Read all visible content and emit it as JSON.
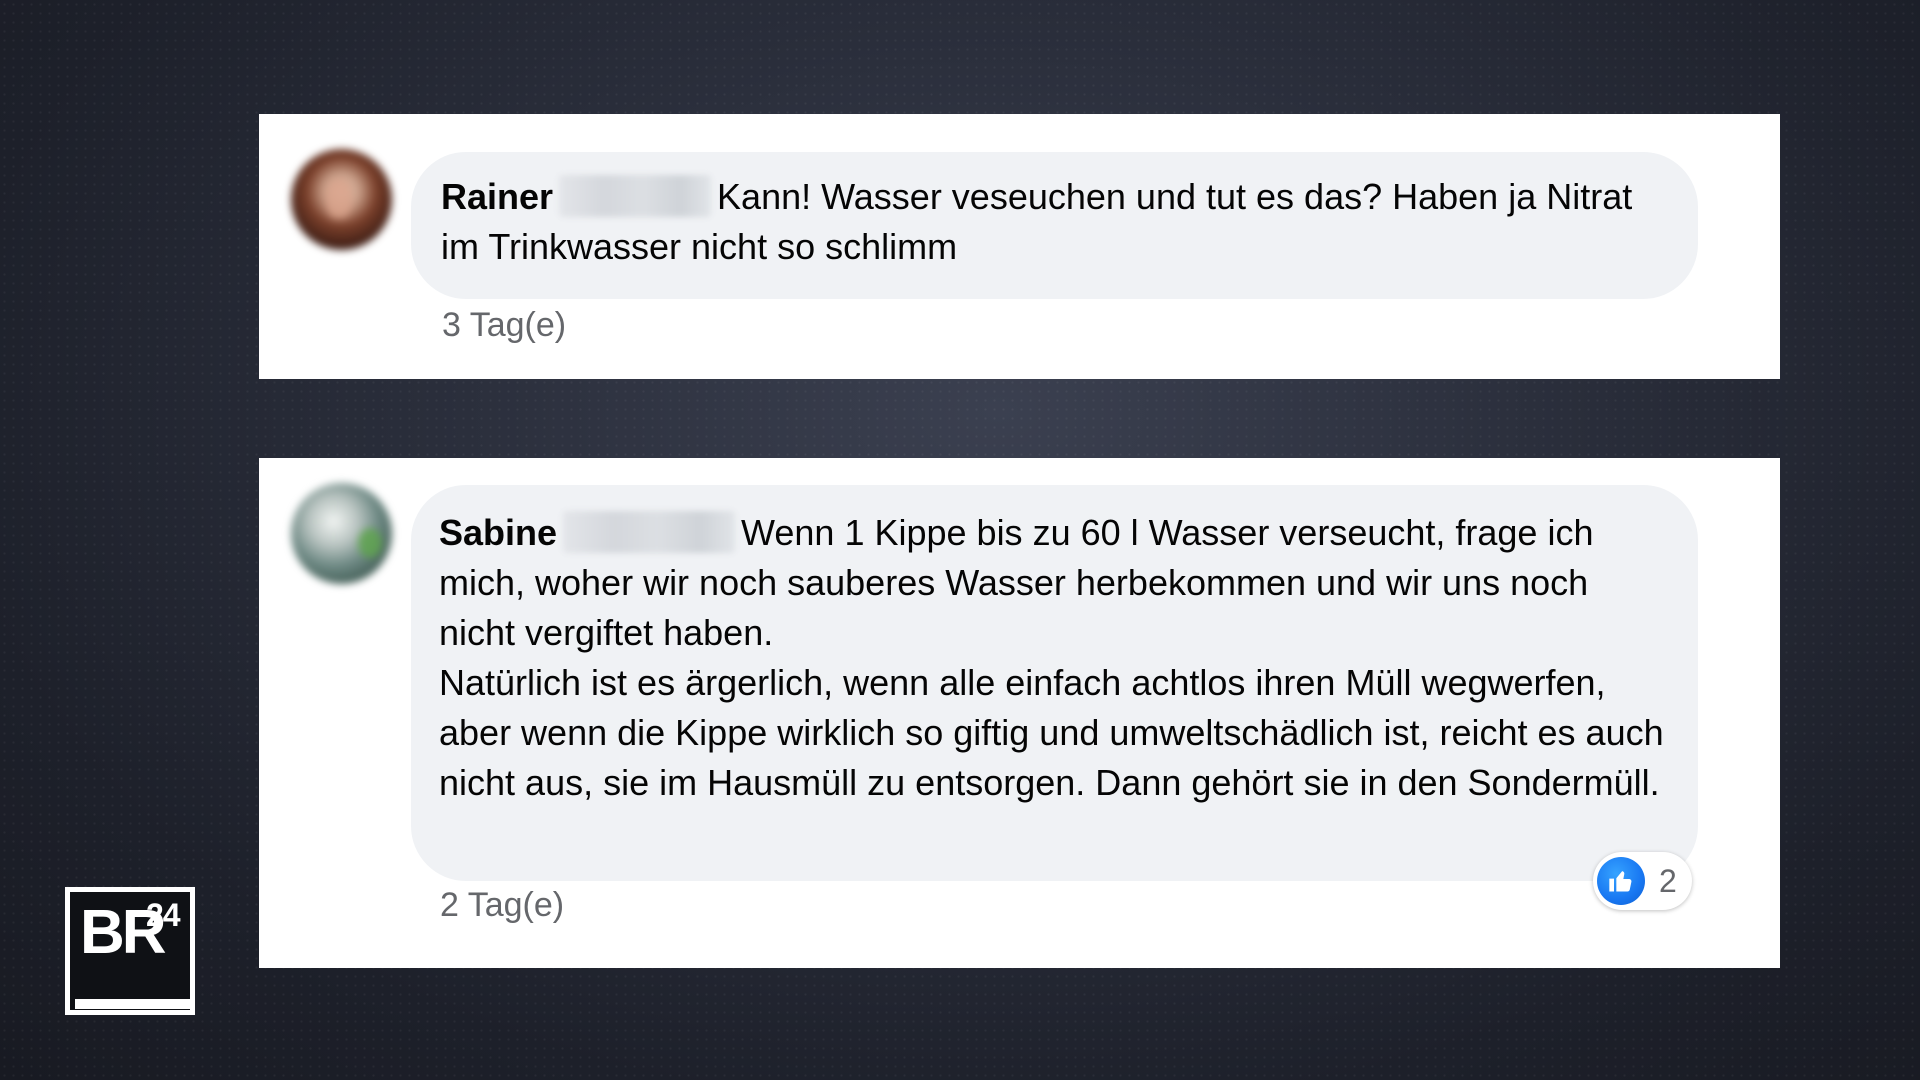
{
  "comments": [
    {
      "author": "Rainer",
      "text": "Kann! Wasser veseuchen und tut es das? Haben ja Nitrat im Trinkwasser nicht so schlimm",
      "timestamp": "3 Tag(e)"
    },
    {
      "author": "Sabine",
      "text": "Wenn 1 Kippe bis zu 60 l Wasser verseucht, frage ich mich, woher wir noch sauberes Wasser herbekommen und wir uns noch nicht vergiftet haben.",
      "text_2": "Natürlich ist es ärgerlich, wenn alle einfach achtlos ihren Müll wegwerfen, aber wenn die Kippe wirklich so giftig und umweltschädlich ist, reicht es auch nicht aus, sie im Hausmüll zu entsorgen. Dann gehört sie in den Sondermüll.",
      "timestamp": "2 Tag(e)",
      "reaction": {
        "icon": "thumbs-up-icon",
        "count": "2",
        "color": "#1877f2"
      }
    }
  ],
  "logo": {
    "brand": "BR",
    "number": "24"
  }
}
